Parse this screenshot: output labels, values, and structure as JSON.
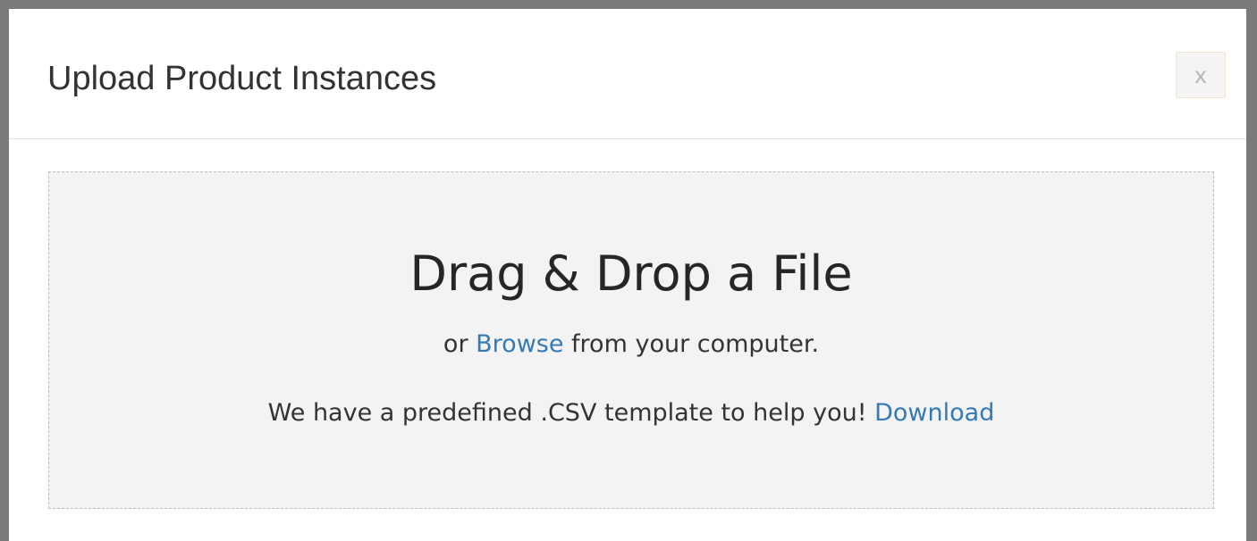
{
  "modal": {
    "title": "Upload Product Instances",
    "close_label": "x"
  },
  "dropzone": {
    "heading": "Drag & Drop a File",
    "browse_prefix": "or",
    "browse_link": "Browse",
    "browse_suffix": "from your computer.",
    "template_text": "We have a predefined .CSV template to help you!",
    "download_link": "Download"
  },
  "colors": {
    "link": "#337ab7",
    "dropzone_background": "#f3f3f4",
    "dropzone_border": "#bdbdbd"
  }
}
